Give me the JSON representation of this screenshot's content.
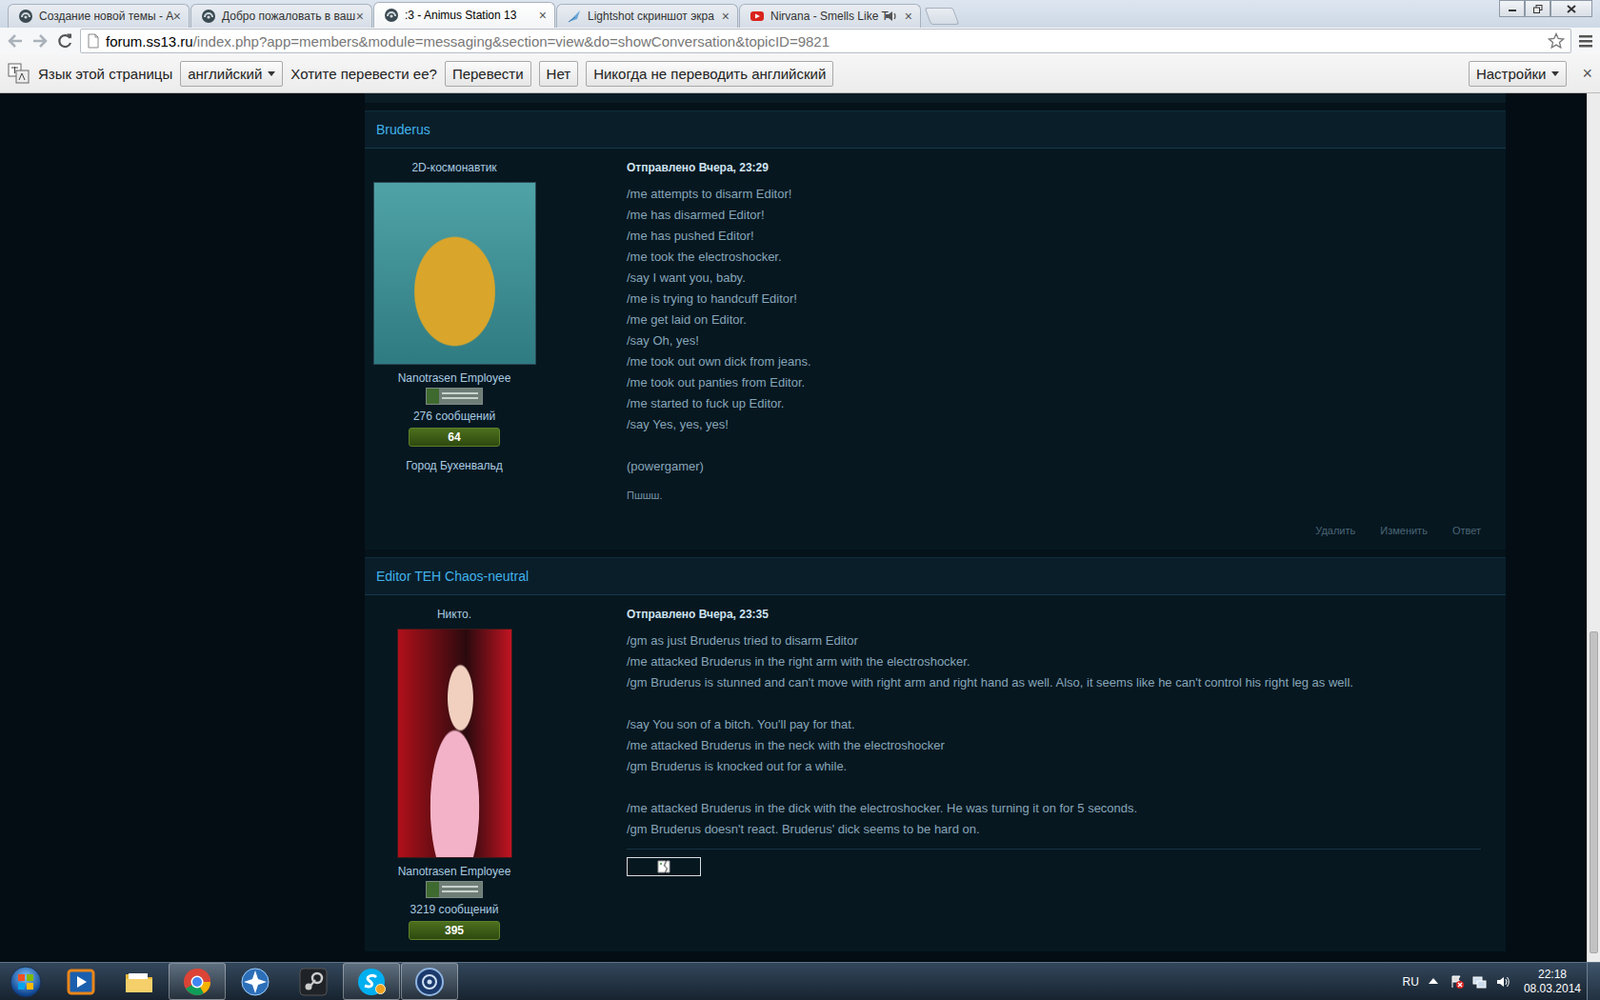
{
  "browser": {
    "tabs": [
      {
        "label": "Создание новой темы - A",
        "selected": false,
        "kind": "forum",
        "audio": false
      },
      {
        "label": "Добро пожаловать в ваш",
        "selected": false,
        "kind": "forum",
        "audio": false
      },
      {
        "label": ":3 - Animus Station 13",
        "selected": true,
        "kind": "forum",
        "audio": false
      },
      {
        "label": "Lightshot скриншот экра",
        "selected": false,
        "kind": "lightshot",
        "audio": false
      },
      {
        "label": "Nirvana - Smells Like T",
        "selected": false,
        "kind": "youtube",
        "audio": true
      }
    ],
    "tab_close": "×",
    "can_go_back": false,
    "can_go_forward": false,
    "address": {
      "domain": "forum.ss13.ru",
      "path": "/index.php?app=members&module=messaging&section=view&do=showConversation&topicID=9821"
    },
    "bookmarked": false
  },
  "translate_bar": {
    "page_language_label": "Язык этой страницы",
    "language": "английский",
    "question": "Хотите перевести ее?",
    "buttons": [
      "Перевести",
      "Нет",
      "Никогда не переводить английский"
    ],
    "settings": "Настройки",
    "close": "×"
  },
  "posts": [
    {
      "author": "Bruderus",
      "title": "2D-космонавтик",
      "group": "Nanotrasen Employee",
      "post_count": "276 сообщений",
      "reputation": "64",
      "location": "Город Бухенвальд",
      "date": "Отправлено Вчера, 23:29",
      "paragraphs": [
        [
          "/me attempts to disarm Editor!",
          "/me has disarmed Editor!",
          "/me has pushed Editor!",
          "/me took the electroshocker.",
          "/say I want you, baby.",
          "/me is trying to handcuff Editor!",
          "/me get laid on Editor.",
          "/say Oh, yes!",
          "/me took out own dick from jeans.",
          "/me took out panties from Editor.",
          "/me started to fuck up Editor.",
          "/say Yes, yes, yes!"
        ],
        [
          "(powergamer)"
        ]
      ],
      "signature": "Пшшш.",
      "actions": [
        "Удалить",
        "Изменить",
        "Ответ"
      ],
      "broken_image": false
    },
    {
      "author": "Editor TEH Chaos-neutral",
      "title": "Никто.",
      "group": "Nanotrasen Employee",
      "post_count": "3219 сообщений",
      "reputation": "395",
      "date": "Отправлено Вчера, 23:35",
      "paragraphs": [
        [
          "/gm as just Bruderus tried to disarm Editor",
          "/me attacked Bruderus in the right arm with the electroshocker.",
          "/gm Bruderus is stunned and can't move with right arm and right hand as well. Also, it seems like he can't control his right leg as well."
        ],
        [
          "/say You son of a bitch. You'll pay for that.",
          "/me attacked Bruderus in the neck with the electroshocker",
          "/gm Bruderus is knocked out for a while."
        ],
        [
          "/me attacked Bruderus in the dick with the electroshocker. He was turning it on for 5 seconds.",
          "/gm Bruderus doesn't react. Bruderus' dick seems to be hard on."
        ]
      ],
      "broken_image": true
    }
  ],
  "scrollbar": {
    "thumb_start": 0.62,
    "level": 0.37
  },
  "taskbar": {
    "items": [
      {
        "kind": "start",
        "running": false,
        "notification": false
      },
      {
        "kind": "media",
        "running": false,
        "notification": false
      },
      {
        "kind": "explorer",
        "running": false,
        "notification": false
      },
      {
        "kind": "chrome",
        "running": true,
        "notification": false
      },
      {
        "kind": "star",
        "running": false,
        "notification": false
      },
      {
        "kind": "steam",
        "running": false,
        "notification": false
      },
      {
        "kind": "skype",
        "running": true,
        "notification": true
      },
      {
        "kind": "ss13",
        "running": true,
        "notification": false
      }
    ],
    "language": "RU",
    "tray": [
      {
        "kind": "arrow"
      },
      {
        "kind": "flag"
      },
      {
        "kind": "network"
      },
      {
        "kind": "volume"
      }
    ],
    "time": "22:18",
    "date": "08.03.2014"
  }
}
